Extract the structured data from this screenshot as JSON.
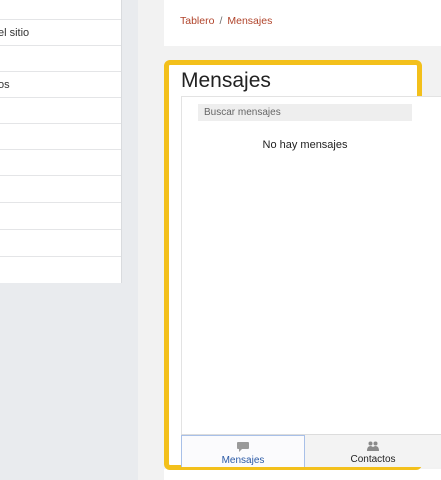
{
  "drawer": {
    "items": [
      {
        "label": "el sitio"
      },
      {
        "label": ""
      },
      {
        "label": "os"
      },
      {
        "label": ""
      },
      {
        "label": ""
      },
      {
        "label": ""
      },
      {
        "label": ""
      },
      {
        "label": ""
      },
      {
        "label": ""
      },
      {
        "label": ""
      }
    ]
  },
  "breadcrumb": {
    "home": "Tablero",
    "separator": "/",
    "current": "Mensajes"
  },
  "messages": {
    "title": "Mensajes",
    "search_placeholder": "Buscar mensajes",
    "empty_text": "No hay mensajes",
    "tabs": [
      {
        "label": "Mensajes",
        "icon": "speech-bubble-icon",
        "active": true
      },
      {
        "label": "Contactos",
        "icon": "users-icon",
        "active": false
      }
    ]
  },
  "colors": {
    "highlight": "#f3c01b",
    "link": "#b0432a",
    "active_tab": "#2b5aa6"
  }
}
